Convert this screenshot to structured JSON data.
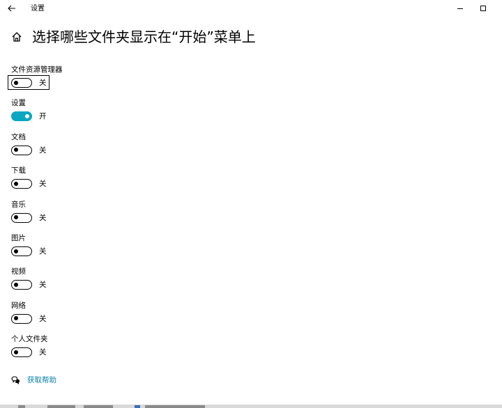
{
  "window": {
    "title": "设置"
  },
  "header": {
    "title": "选择哪些文件夹显示在“开始”菜单上"
  },
  "colors": {
    "accent": "#0aa6c2",
    "link": "#0a7fa8",
    "background": "#ffffff"
  },
  "icons": {
    "back": "back-arrow-icon",
    "minimize": "minimize-icon",
    "maximize": "maximize-icon",
    "home": "home-icon",
    "help": "help-chat-icon"
  },
  "settings": [
    {
      "label": "文件资源管理器",
      "state": "关",
      "on": false,
      "focused": true
    },
    {
      "label": "设置",
      "state": "开",
      "on": true,
      "focused": false
    },
    {
      "label": "文档",
      "state": "关",
      "on": false,
      "focused": false
    },
    {
      "label": "下载",
      "state": "关",
      "on": false,
      "focused": false
    },
    {
      "label": "音乐",
      "state": "关",
      "on": false,
      "focused": false
    },
    {
      "label": "图片",
      "state": "关",
      "on": false,
      "focused": false
    },
    {
      "label": "视频",
      "state": "关",
      "on": false,
      "focused": false
    },
    {
      "label": "网络",
      "state": "关",
      "on": false,
      "focused": false
    },
    {
      "label": "个人文件夹",
      "state": "关",
      "on": false,
      "focused": false
    }
  ],
  "help": {
    "label": "获取帮助"
  }
}
